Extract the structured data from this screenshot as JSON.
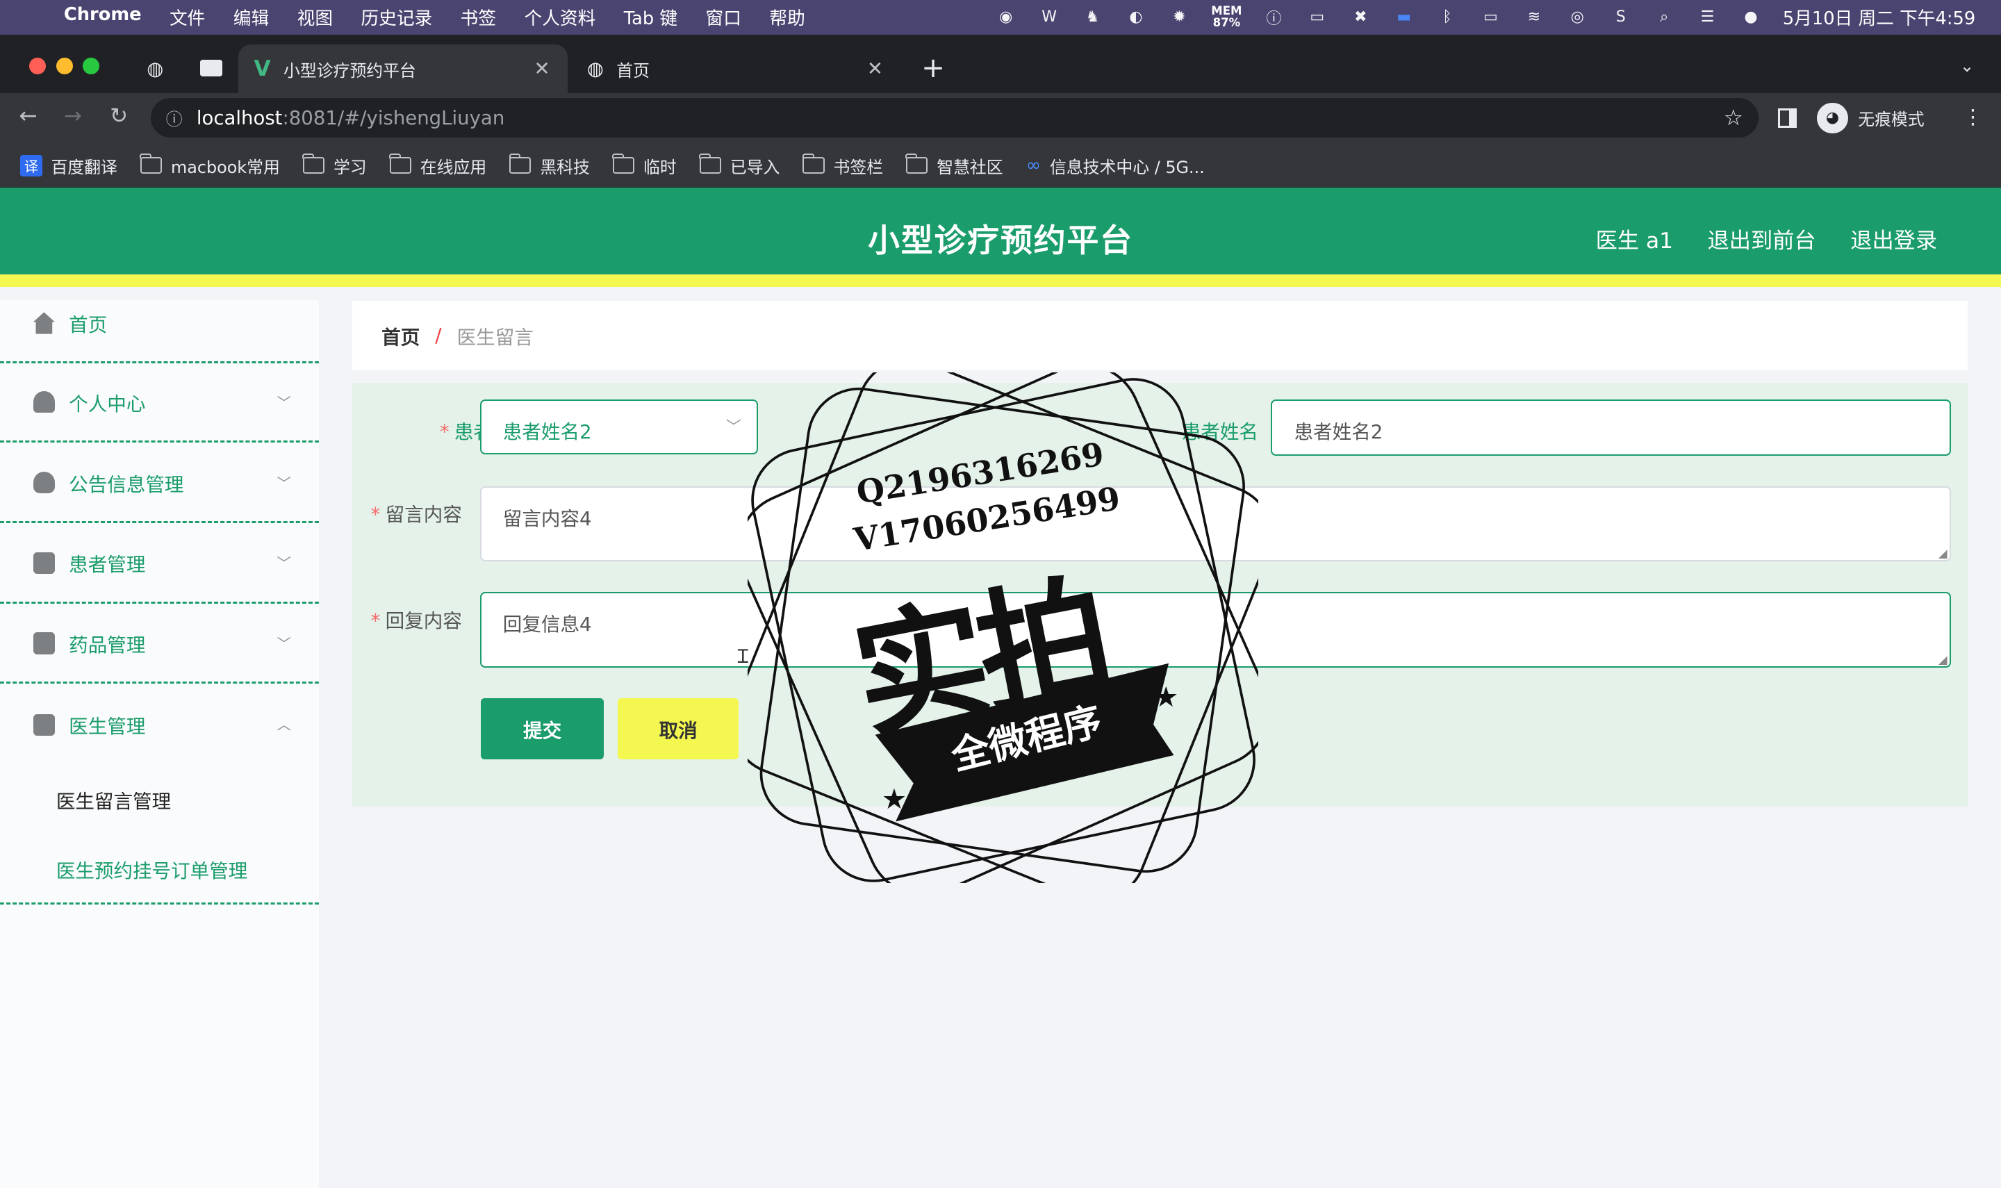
{
  "menubar": {
    "app": "Chrome",
    "items": [
      "文件",
      "编辑",
      "视图",
      "历史记录",
      "书签",
      "个人资料",
      "Tab 键",
      "窗口",
      "帮助"
    ],
    "mem_label": "MEM",
    "mem_value": "87%",
    "datetime": "5月10日 周二 下午4:59"
  },
  "browser": {
    "tabs": [
      {
        "title": "小型诊疗预约平台",
        "active": true
      },
      {
        "title": "首页",
        "active": false
      }
    ],
    "url_host": "localhost",
    "url_path": ":8081/#/yishengLiuyan",
    "profile_label": "无痕模式",
    "bookmarks": [
      "百度翻译",
      "macbook常用",
      "学习",
      "在线应用",
      "黑科技",
      "临时",
      "已导入",
      "书签栏",
      "智慧社区",
      "信息技术中心 / 5G..."
    ]
  },
  "header": {
    "title": "小型诊疗预约平台",
    "links": [
      "医生 a1",
      "退出到前台",
      "退出登录"
    ]
  },
  "sidebar": {
    "items": [
      {
        "label": "首页",
        "icon": "home-icon"
      },
      {
        "label": "个人中心",
        "icon": "user-icon"
      },
      {
        "label": "公告信息管理",
        "icon": "bulb-icon"
      },
      {
        "label": "患者管理",
        "icon": "monitor-icon"
      },
      {
        "label": "药品管理",
        "icon": "medicine-icon"
      },
      {
        "label": "医生管理",
        "icon": "clipboard-icon"
      }
    ],
    "sub_items": [
      "医生留言管理",
      "医生预约挂号订单管理"
    ]
  },
  "breadcrumb": {
    "home": "首页",
    "separator": "/",
    "current": "医生留言"
  },
  "form": {
    "patient_label": "患者",
    "patient_value": "患者姓名2",
    "patient_name_label": "患者姓名",
    "patient_name_value": "患者姓名2",
    "message_label": "留言内容",
    "message_value": "留言内容4",
    "reply_label": "回复内容",
    "reply_value": "回复信息4",
    "submit_label": "提交",
    "cancel_label": "取消"
  },
  "watermark": {
    "qq": "Q2196316269",
    "vx": "V17060256499",
    "big_text": "实拍",
    "ribbon_text": "全微程序"
  },
  "colors": {
    "primary": "#1a9c6b",
    "accent_yellow": "#f3f74f",
    "form_bg": "#e4f2ea"
  }
}
